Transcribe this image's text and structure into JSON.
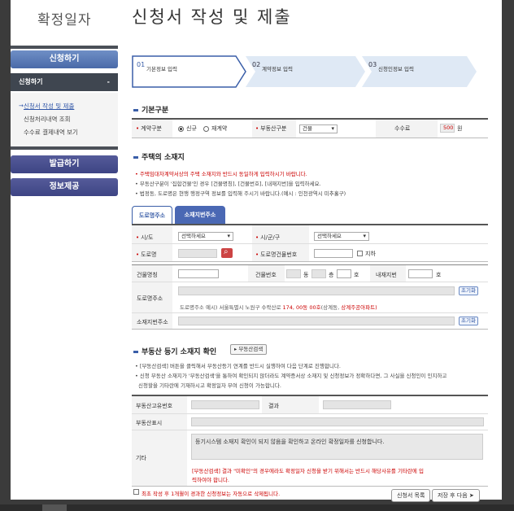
{
  "sidebar": {
    "site_title": "확정일자",
    "apply_header": "신청하기",
    "sub_header": "신청하기",
    "sub_toggle": "-",
    "menu": [
      "신청서 작성 및 제출",
      "신청처리내역 조회",
      "수수료 결제내역 보기"
    ],
    "issue_button": "발급하기",
    "info_button": "정보제공"
  },
  "page_title": "신청서 작성 및 제출",
  "steps": [
    {
      "num": "01",
      "label": "기본정보 입력"
    },
    {
      "num": "02",
      "label": "계약정보 입력"
    },
    {
      "num": "03",
      "label": "신청인정보 입력"
    }
  ],
  "basic": {
    "title": "기본구분",
    "contract_type_label": "계약구분",
    "contract_new": "신규",
    "contract_renew": "재계약",
    "property_type_label": "부동산구분",
    "property_type_value": "건물",
    "fee_label": "수수료",
    "fee_value": "500",
    "fee_unit": "원"
  },
  "address": {
    "title": "주택의 소재지",
    "notes": [
      "주택임대차계약서상의 주택 소재지와 반드시 동일하게 입력하시기 바랍니다.",
      "부동산구분이 '집합건물'인 경우 [건물명칭], [건물번호], [내재지번]을 입력하세요.",
      "법정동, 도로명은 현행 행정구역 정보를 입력해 주시기 바랍니다.(예시 : 인천광역시 미추홀구)"
    ],
    "tab_road": "도로명주소",
    "tab_lot": "소재지번주소",
    "sido_label": "시/도",
    "sido_value": "선택하세요",
    "sigungu_label": "시/군/구",
    "sigungu_value": "선택하세요",
    "road_label": "도로명",
    "road_bldg_no_label": "도로명건물번호",
    "basement_label": "지하",
    "bldg_name_label": "건물명칭",
    "bldg_no_label": "건물번호",
    "dong_unit": "동",
    "floor_unit": "층",
    "ho_unit": "호",
    "inner_lot_label": "내재지번",
    "road_addr_label": "도로명주소",
    "reset_label": "초기화",
    "road_example_prefix": "도로명주소 예시) 서울특별시 노원구 수락산로",
    "road_example_highlight": "174, 00동 00호",
    "road_example_mid": "(상계동,",
    "road_example_tail": "상계주공아파트)",
    "lot_addr_label": "소재지번주소"
  },
  "registry": {
    "title": "부동산 등기 소재지 확인",
    "search_button": "부동산검색",
    "notes": [
      "[부동산검색] 버튼을 클릭해서 부동산등기 연계를 반드시 실행하여 다음 단계로 진행합니다.",
      "신청 부동산 소재지가 '부동산검색'을 통하여 확인되지 않더라도 계약증서상 소재지 및 신청정보가 정확하다면, 그 사실을 신청인이 인지하고",
      "신청할을 기타란에 기재하시고 확정일자 부여 신청이 가능합니다."
    ],
    "unique_no_label": "부동산고유번호",
    "result_label": "결과",
    "display_label": "부동산표시",
    "etc_label": "기타",
    "etc_text": "등기시스템 소재지 확인이 되지 않음을 확인하고 온라인 확정일자를 신청합니다.",
    "warning_line1": "[부동산검색] 결과 \"미확인\"의 경우에라도 확정일자 신청을 받기 위해서는 반드시 해당사유를 기타란에 입",
    "warning_line2": "력하여야 합니다."
  },
  "footer": {
    "checkbox_label": "최초 작성 후 1개월이 경과한 신청정보는 자동으로 삭제됩니다.",
    "list_button": "신청서 목록",
    "next_button": "저장 후 다음"
  },
  "colors": {
    "accent": "#3a5ea8",
    "warning": "#cc0000",
    "side_btn": "#5a7ab8"
  }
}
